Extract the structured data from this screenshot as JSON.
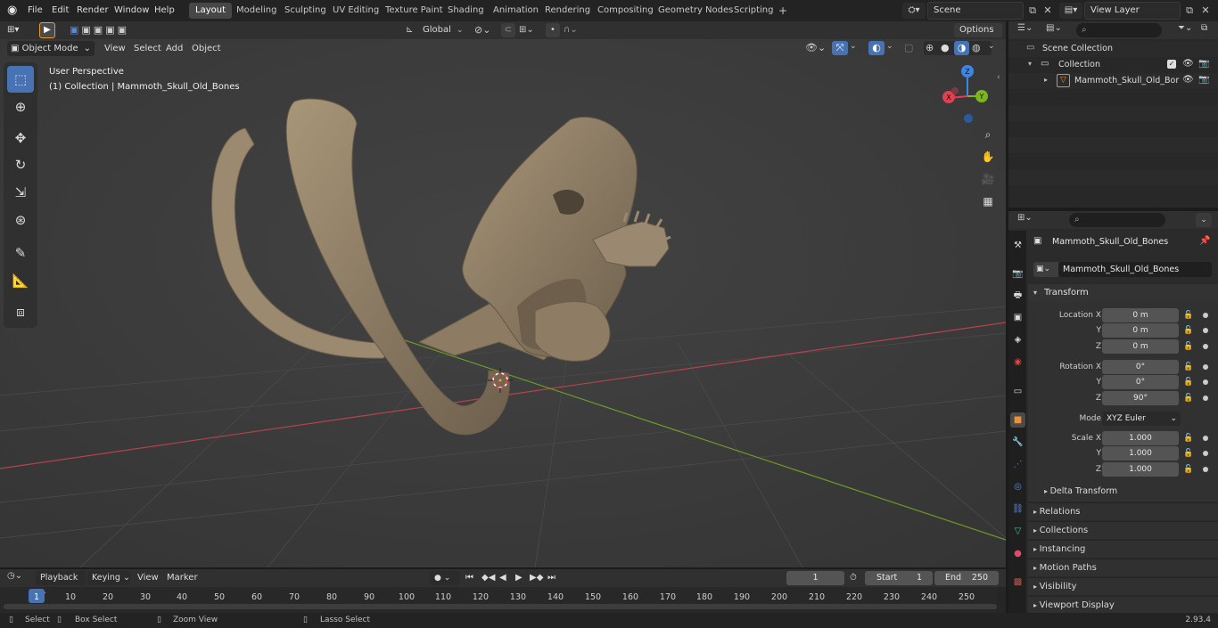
{
  "topbar": {
    "menus": [
      "File",
      "Edit",
      "Render",
      "Window",
      "Help"
    ],
    "workspaces": [
      "Layout",
      "Modeling",
      "Sculpting",
      "UV Editing",
      "Texture Paint",
      "Shading",
      "Animation",
      "Rendering",
      "Compositing",
      "Geometry Nodes",
      "Scripting"
    ],
    "active_workspace": "Layout",
    "add_tab": "+",
    "scene": "Scene",
    "view_layer": "View Layer"
  },
  "viewport_header": {
    "transform_orientation": "Global",
    "options": "Options",
    "mode": "Object Mode",
    "menus": [
      "View",
      "Select",
      "Add",
      "Object"
    ]
  },
  "viewport": {
    "perspective": "User Perspective",
    "collection_info": "(1) Collection | Mammoth_Skull_Old_Bones",
    "gizmo": {
      "x": "X",
      "y": "Y",
      "z": "Z"
    }
  },
  "outliner": {
    "scene_collection": "Scene Collection",
    "collection": "Collection",
    "object": "Mammoth_Skull_Old_Bor"
  },
  "properties": {
    "object_name": "Mammoth_Skull_Old_Bones",
    "data_name": "Mammoth_Skull_Old_Bones",
    "transform_title": "Transform",
    "location_label": "Location X",
    "rotation_label": "Rotation X",
    "scale_label": "Scale X",
    "axis_y": "Y",
    "axis_z": "Z",
    "location": [
      "0 m",
      "0 m",
      "0 m"
    ],
    "rotation": [
      "0°",
      "0°",
      "90°"
    ],
    "mode_label": "Mode",
    "mode_value": "XYZ Euler",
    "scale": [
      "1.000",
      "1.000",
      "1.000"
    ],
    "delta_transform": "Delta Transform",
    "sections": [
      "Relations",
      "Collections",
      "Instancing",
      "Motion Paths",
      "Visibility",
      "Viewport Display"
    ]
  },
  "timeline": {
    "menus": [
      "Playback",
      "Keying",
      "View",
      "Marker"
    ],
    "current_frame": "1",
    "start_label": "Start",
    "start_value": "1",
    "end_label": "End",
    "end_value": "250",
    "ticks": [
      "1",
      "10",
      "20",
      "30",
      "40",
      "50",
      "60",
      "70",
      "80",
      "90",
      "100",
      "110",
      "120",
      "130",
      "140",
      "150",
      "160",
      "170",
      "180",
      "190",
      "200",
      "210",
      "220",
      "230",
      "240",
      "250"
    ]
  },
  "statusbar": {
    "select": "Select",
    "box_select": "Box Select",
    "zoom_view": "Zoom View",
    "lasso_select": "Lasso Select",
    "version": "2.93.4"
  },
  "colors": {
    "accent": "#4772b3",
    "x_axis": "#e0404f",
    "y_axis": "#7db51c",
    "z_axis": "#3c86e6",
    "bone": "#8a7a63"
  }
}
